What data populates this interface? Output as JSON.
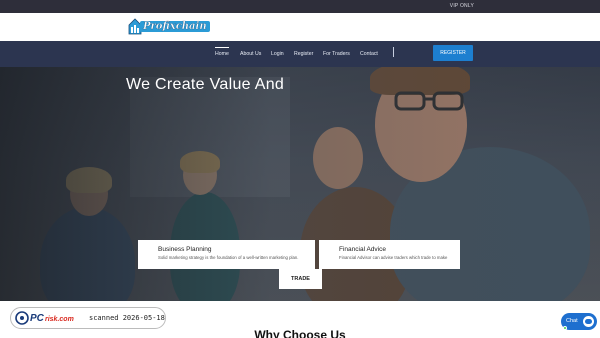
{
  "topbar": {
    "vip_label": "VIP ONLY"
  },
  "brand": {
    "logo_text": "Profixchain"
  },
  "nav": {
    "items": [
      {
        "label": "Home",
        "active": true
      },
      {
        "label": "About Us"
      },
      {
        "label": "Login"
      },
      {
        "label": "Register"
      },
      {
        "label": "For Traders"
      },
      {
        "label": "Contact"
      }
    ],
    "register_button": "REGISTER"
  },
  "hero": {
    "title": "We Create Value And",
    "cards": [
      {
        "title": "Business Planning",
        "desc": "Solid marketing strategy is the foundation of a well-written marketing plan."
      },
      {
        "title": "Financial Advice",
        "desc": "Financial Advisor can advise traders which trade to make"
      }
    ],
    "trade_button": "TRADE"
  },
  "watermark": {
    "brand": "PCrisk.com",
    "scanned": "scanned 2026-05-18"
  },
  "section": {
    "heading": "Why Choose Us"
  },
  "chat": {
    "label": "Chat"
  },
  "colors": {
    "topbar": "#2e2e3a",
    "navbar": "#2c3550",
    "accent": "#1d7fd0",
    "chat": "#1e6fcf"
  }
}
